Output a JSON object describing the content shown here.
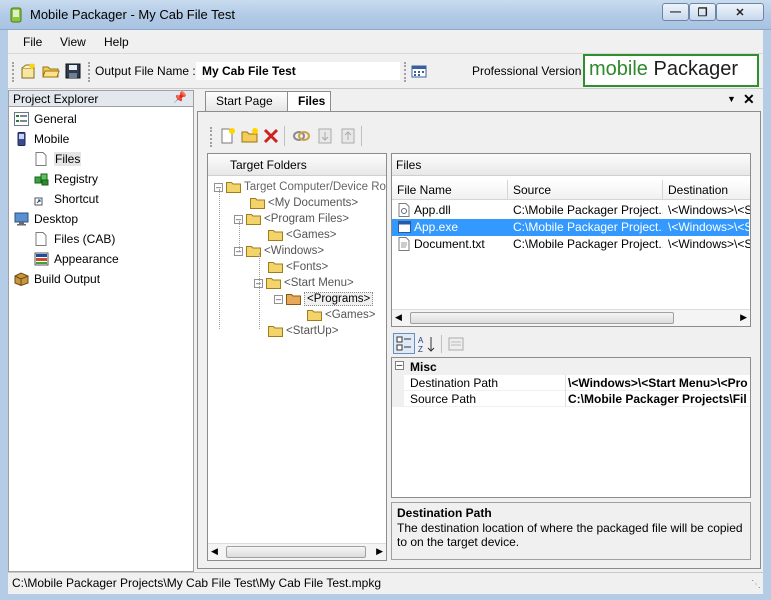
{
  "window": {
    "title": "Mobile Packager - My Cab File Test"
  },
  "menu": {
    "items": [
      "File",
      "View",
      "Help"
    ]
  },
  "toolbar": {
    "output_label": "Output File Name :",
    "output_value": "My Cab File Test",
    "edition": "Professional Version"
  },
  "logo": {
    "word1": "mobile",
    "word2": "Packager"
  },
  "project_explorer": {
    "title": "Project Explorer",
    "items": [
      {
        "label": "General",
        "icon": "settings-list-icon"
      },
      {
        "label": "Mobile",
        "icon": "mobile-device-icon"
      },
      {
        "label": "Files",
        "icon": "file-icon"
      },
      {
        "label": "Registry",
        "icon": "registry-cubes-icon"
      },
      {
        "label": "Shortcut",
        "icon": "shortcut-icon"
      },
      {
        "label": "Desktop",
        "icon": "desktop-computer-icon"
      },
      {
        "label": "Files (CAB)",
        "icon": "file-icon"
      },
      {
        "label": "Appearance",
        "icon": "appearance-icon"
      },
      {
        "label": "Build Output",
        "icon": "package-box-icon"
      }
    ]
  },
  "tabs": [
    {
      "label": "Start Page"
    },
    {
      "label": "Files"
    }
  ],
  "target_folders": {
    "header": "Target Folders",
    "items": [
      {
        "label": "Target Computer/Device Ro"
      },
      {
        "label": "<My Documents>"
      },
      {
        "label": "<Program Files>"
      },
      {
        "label": "<Games>"
      },
      {
        "label": "<Windows>"
      },
      {
        "label": "<Fonts>"
      },
      {
        "label": "<Start Menu>"
      },
      {
        "label": "<Programs>"
      },
      {
        "label": "<Games>"
      },
      {
        "label": "<StartUp>"
      }
    ]
  },
  "files": {
    "header": "Files",
    "columns": [
      "File Name",
      "Source",
      "Destination"
    ],
    "rows": [
      {
        "name": "App.dll",
        "source": "C:\\Mobile Packager Project...",
        "destination": "\\<Windows>\\<St"
      },
      {
        "name": "App.exe",
        "source": "C:\\Mobile Packager Project...",
        "destination": "\\<Windows>\\<St"
      },
      {
        "name": "Document.txt",
        "source": "C:\\Mobile Packager Project...",
        "destination": "\\<Windows>\\<St"
      }
    ]
  },
  "properties": {
    "category": "Misc",
    "rows": [
      {
        "name": "Destination Path",
        "value": "\\<Windows>\\<Start Menu>\\<Pro"
      },
      {
        "name": "Source Path",
        "value": "C:\\Mobile Packager Projects\\Fil"
      }
    ],
    "desc_title": "Destination Path",
    "desc_text": "The destination location of where the packaged file will be copied to on the target device."
  },
  "status": {
    "path": "C:\\Mobile Packager Projects\\My Cab File Test\\My Cab File Test.mpkg"
  },
  "colors": {
    "selection": "#3399ff",
    "logo_green": "#2b8a2b"
  }
}
